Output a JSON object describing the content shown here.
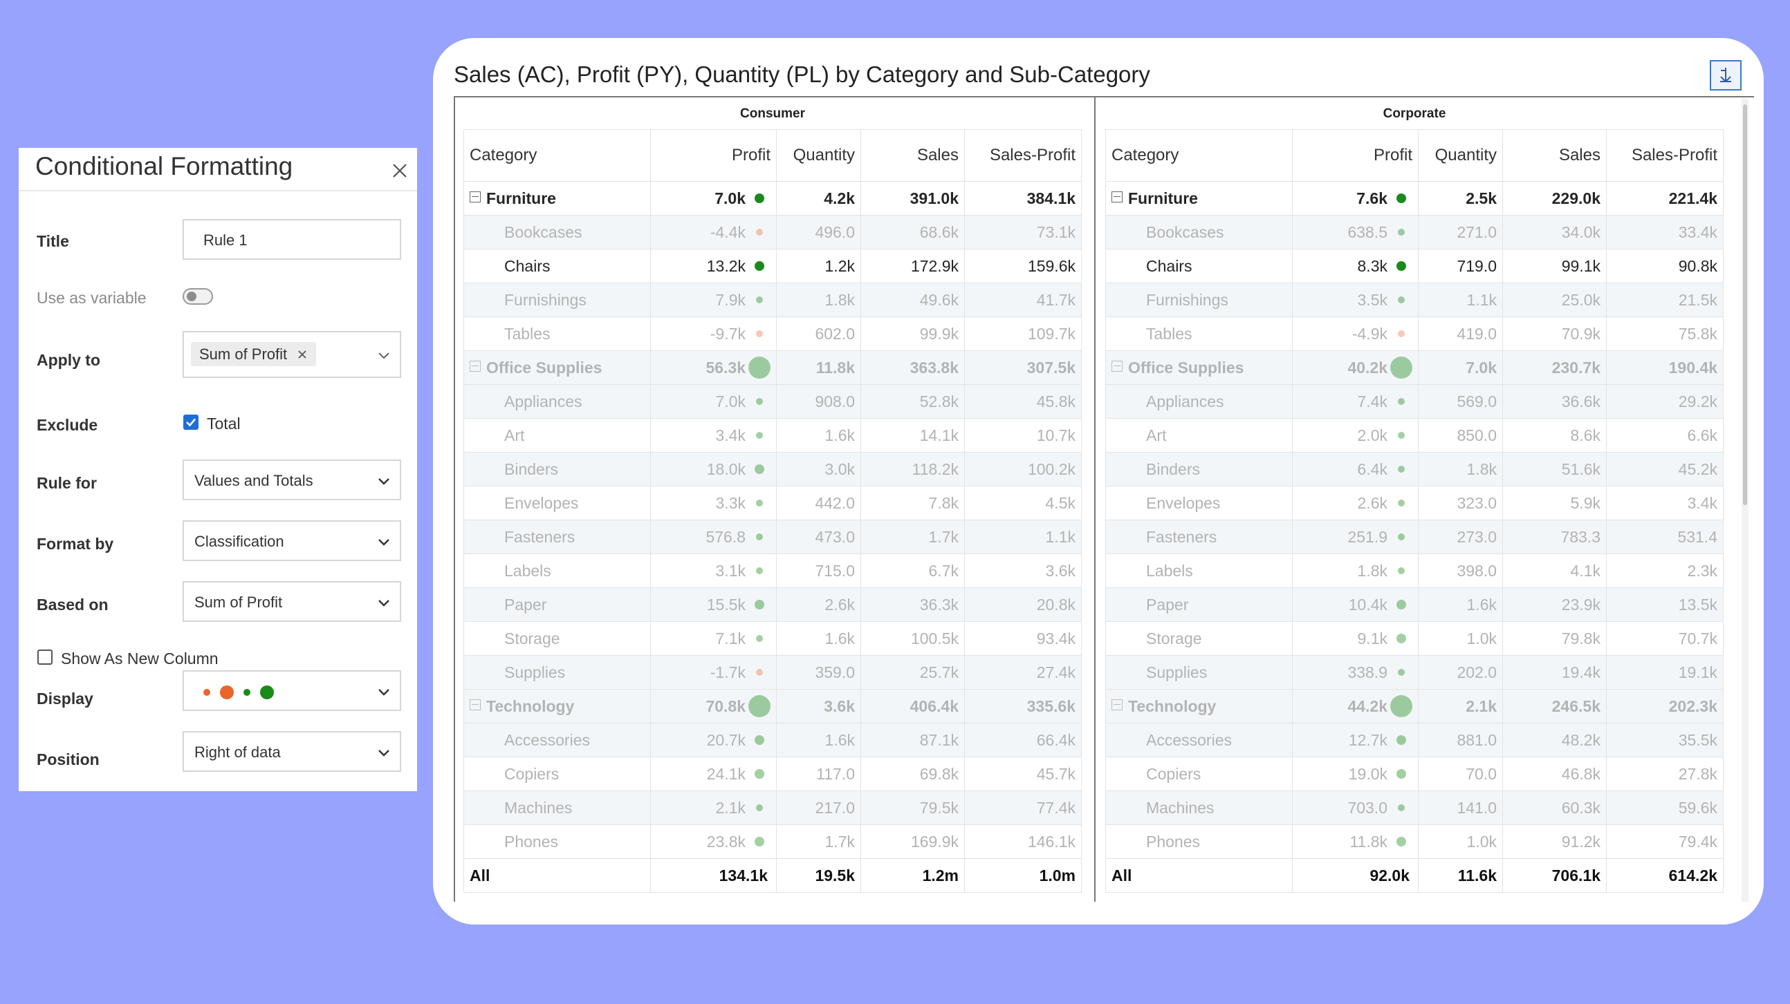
{
  "panel": {
    "title": "Conditional Formatting",
    "fields": {
      "title_label": "Title",
      "title_value": "Rule 1",
      "use_as_variable_label": "Use as variable",
      "use_as_variable_on": false,
      "apply_to_label": "Apply to",
      "apply_to_chip": "Sum of Profit",
      "exclude_label": "Exclude",
      "exclude_option": "Total",
      "exclude_checked": true,
      "rule_for_label": "Rule for",
      "rule_for_value": "Values and Totals",
      "format_by_label": "Format by",
      "format_by_value": "Classification",
      "based_on_label": "Based on",
      "based_on_value": "Sum of Profit",
      "show_new_column_label": "Show As New Column",
      "show_new_column_checked": false,
      "display_label": "Display",
      "display_dot_colors": [
        "#e8652b",
        "#e8652b",
        "#1a8a1a",
        "#1a8a1a"
      ],
      "position_label": "Position",
      "position_value": "Right of data"
    }
  },
  "report": {
    "title": "Sales (AC), Profit (PY), Quantity (PL) by Category and Sub-Category",
    "drill_icon": "hierarchy-icon",
    "columns": [
      "Category",
      "Profit",
      "Quantity",
      "Sales",
      "Sales-Profit"
    ],
    "colors": {
      "positive": "#1a8a1a",
      "negative": "#e8652b"
    },
    "groups": [
      {
        "name": "Consumer",
        "rows": [
          {
            "type": "cat",
            "label": "Furniture",
            "profit": "7.0k",
            "ind": "pos",
            "size": "md",
            "faded": false,
            "qty": "4.2k",
            "sales": "391.0k",
            "sp": "384.1k"
          },
          {
            "type": "sub",
            "label": "Bookcases",
            "profit": "-4.4k",
            "ind": "neg",
            "size": "sm",
            "faded": true,
            "qty": "496.0",
            "sales": "68.6k",
            "sp": "73.1k"
          },
          {
            "type": "sub",
            "label": "Chairs",
            "profit": "13.2k",
            "ind": "pos",
            "size": "md",
            "faded": false,
            "qty": "1.2k",
            "sales": "172.9k",
            "sp": "159.6k"
          },
          {
            "type": "sub",
            "label": "Furnishings",
            "profit": "7.9k",
            "ind": "pos",
            "size": "sm",
            "faded": true,
            "qty": "1.8k",
            "sales": "49.6k",
            "sp": "41.7k"
          },
          {
            "type": "sub",
            "label": "Tables",
            "profit": "-9.7k",
            "ind": "neg",
            "size": "sm",
            "faded": true,
            "qty": "602.0",
            "sales": "99.9k",
            "sp": "109.7k"
          },
          {
            "type": "cat",
            "label": "Office Supplies",
            "profit": "56.3k",
            "ind": "pos",
            "size": "lg",
            "faded": true,
            "qty": "11.8k",
            "sales": "363.8k",
            "sp": "307.5k"
          },
          {
            "type": "sub",
            "label": "Appliances",
            "profit": "7.0k",
            "ind": "pos",
            "size": "sm",
            "faded": true,
            "qty": "908.0",
            "sales": "52.8k",
            "sp": "45.8k"
          },
          {
            "type": "sub",
            "label": "Art",
            "profit": "3.4k",
            "ind": "pos",
            "size": "sm",
            "faded": true,
            "qty": "1.6k",
            "sales": "14.1k",
            "sp": "10.7k"
          },
          {
            "type": "sub",
            "label": "Binders",
            "profit": "18.0k",
            "ind": "pos",
            "size": "md",
            "faded": true,
            "qty": "3.0k",
            "sales": "118.2k",
            "sp": "100.2k"
          },
          {
            "type": "sub",
            "label": "Envelopes",
            "profit": "3.3k",
            "ind": "pos",
            "size": "sm",
            "faded": true,
            "qty": "442.0",
            "sales": "7.8k",
            "sp": "4.5k"
          },
          {
            "type": "sub",
            "label": "Fasteners",
            "profit": "576.8",
            "ind": "pos",
            "size": "sm",
            "faded": true,
            "qty": "473.0",
            "sales": "1.7k",
            "sp": "1.1k"
          },
          {
            "type": "sub",
            "label": "Labels",
            "profit": "3.1k",
            "ind": "pos",
            "size": "sm",
            "faded": true,
            "qty": "715.0",
            "sales": "6.7k",
            "sp": "3.6k"
          },
          {
            "type": "sub",
            "label": "Paper",
            "profit": "15.5k",
            "ind": "pos",
            "size": "md",
            "faded": true,
            "qty": "2.6k",
            "sales": "36.3k",
            "sp": "20.8k"
          },
          {
            "type": "sub",
            "label": "Storage",
            "profit": "7.1k",
            "ind": "pos",
            "size": "sm",
            "faded": true,
            "qty": "1.6k",
            "sales": "100.5k",
            "sp": "93.4k"
          },
          {
            "type": "sub",
            "label": "Supplies",
            "profit": "-1.7k",
            "ind": "neg",
            "size": "sm",
            "faded": true,
            "qty": "359.0",
            "sales": "25.7k",
            "sp": "27.4k"
          },
          {
            "type": "cat",
            "label": "Technology",
            "profit": "70.8k",
            "ind": "pos",
            "size": "lg",
            "faded": true,
            "qty": "3.6k",
            "sales": "406.4k",
            "sp": "335.6k"
          },
          {
            "type": "sub",
            "label": "Accessories",
            "profit": "20.7k",
            "ind": "pos",
            "size": "md",
            "faded": true,
            "qty": "1.6k",
            "sales": "87.1k",
            "sp": "66.4k"
          },
          {
            "type": "sub",
            "label": "Copiers",
            "profit": "24.1k",
            "ind": "pos",
            "size": "md",
            "faded": true,
            "qty": "117.0",
            "sales": "69.8k",
            "sp": "45.7k"
          },
          {
            "type": "sub",
            "label": "Machines",
            "profit": "2.1k",
            "ind": "pos",
            "size": "sm",
            "faded": true,
            "qty": "217.0",
            "sales": "79.5k",
            "sp": "77.4k"
          },
          {
            "type": "sub",
            "label": "Phones",
            "profit": "23.8k",
            "ind": "pos",
            "size": "md",
            "faded": true,
            "qty": "1.7k",
            "sales": "169.9k",
            "sp": "146.1k"
          },
          {
            "type": "total",
            "label": "All",
            "profit": "134.1k",
            "ind": "none",
            "size": "none",
            "faded": false,
            "qty": "19.5k",
            "sales": "1.2m",
            "sp": "1.0m"
          }
        ]
      },
      {
        "name": "Corporate",
        "rows": [
          {
            "type": "cat",
            "label": "Furniture",
            "profit": "7.6k",
            "ind": "pos",
            "size": "md",
            "faded": false,
            "qty": "2.5k",
            "sales": "229.0k",
            "sp": "221.4k"
          },
          {
            "type": "sub",
            "label": "Bookcases",
            "profit": "638.5",
            "ind": "pos",
            "size": "sm",
            "faded": true,
            "qty": "271.0",
            "sales": "34.0k",
            "sp": "33.4k"
          },
          {
            "type": "sub",
            "label": "Chairs",
            "profit": "8.3k",
            "ind": "pos",
            "size": "md",
            "faded": false,
            "qty": "719.0",
            "sales": "99.1k",
            "sp": "90.8k"
          },
          {
            "type": "sub",
            "label": "Furnishings",
            "profit": "3.5k",
            "ind": "pos",
            "size": "sm",
            "faded": true,
            "qty": "1.1k",
            "sales": "25.0k",
            "sp": "21.5k"
          },
          {
            "type": "sub",
            "label": "Tables",
            "profit": "-4.9k",
            "ind": "neg",
            "size": "sm",
            "faded": true,
            "qty": "419.0",
            "sales": "70.9k",
            "sp": "75.8k"
          },
          {
            "type": "cat",
            "label": "Office Supplies",
            "profit": "40.2k",
            "ind": "pos",
            "size": "lg",
            "faded": true,
            "qty": "7.0k",
            "sales": "230.7k",
            "sp": "190.4k"
          },
          {
            "type": "sub",
            "label": "Appliances",
            "profit": "7.4k",
            "ind": "pos",
            "size": "sm",
            "faded": true,
            "qty": "569.0",
            "sales": "36.6k",
            "sp": "29.2k"
          },
          {
            "type": "sub",
            "label": "Art",
            "profit": "2.0k",
            "ind": "pos",
            "size": "sm",
            "faded": true,
            "qty": "850.0",
            "sales": "8.6k",
            "sp": "6.6k"
          },
          {
            "type": "sub",
            "label": "Binders",
            "profit": "6.4k",
            "ind": "pos",
            "size": "sm",
            "faded": true,
            "qty": "1.8k",
            "sales": "51.6k",
            "sp": "45.2k"
          },
          {
            "type": "sub",
            "label": "Envelopes",
            "profit": "2.6k",
            "ind": "pos",
            "size": "sm",
            "faded": true,
            "qty": "323.0",
            "sales": "5.9k",
            "sp": "3.4k"
          },
          {
            "type": "sub",
            "label": "Fasteners",
            "profit": "251.9",
            "ind": "pos",
            "size": "sm",
            "faded": true,
            "qty": "273.0",
            "sales": "783.3",
            "sp": "531.4"
          },
          {
            "type": "sub",
            "label": "Labels",
            "profit": "1.8k",
            "ind": "pos",
            "size": "sm",
            "faded": true,
            "qty": "398.0",
            "sales": "4.1k",
            "sp": "2.3k"
          },
          {
            "type": "sub",
            "label": "Paper",
            "profit": "10.4k",
            "ind": "pos",
            "size": "md",
            "faded": true,
            "qty": "1.6k",
            "sales": "23.9k",
            "sp": "13.5k"
          },
          {
            "type": "sub",
            "label": "Storage",
            "profit": "9.1k",
            "ind": "pos",
            "size": "md",
            "faded": true,
            "qty": "1.0k",
            "sales": "79.8k",
            "sp": "70.7k"
          },
          {
            "type": "sub",
            "label": "Supplies",
            "profit": "338.9",
            "ind": "pos",
            "size": "sm",
            "faded": true,
            "qty": "202.0",
            "sales": "19.4k",
            "sp": "19.1k"
          },
          {
            "type": "cat",
            "label": "Technology",
            "profit": "44.2k",
            "ind": "pos",
            "size": "lg",
            "faded": true,
            "qty": "2.1k",
            "sales": "246.5k",
            "sp": "202.3k"
          },
          {
            "type": "sub",
            "label": "Accessories",
            "profit": "12.7k",
            "ind": "pos",
            "size": "md",
            "faded": true,
            "qty": "881.0",
            "sales": "48.2k",
            "sp": "35.5k"
          },
          {
            "type": "sub",
            "label": "Copiers",
            "profit": "19.0k",
            "ind": "pos",
            "size": "md",
            "faded": true,
            "qty": "70.0",
            "sales": "46.8k",
            "sp": "27.8k"
          },
          {
            "type": "sub",
            "label": "Machines",
            "profit": "703.0",
            "ind": "pos",
            "size": "sm",
            "faded": true,
            "qty": "141.0",
            "sales": "60.3k",
            "sp": "59.6k"
          },
          {
            "type": "sub",
            "label": "Phones",
            "profit": "11.8k",
            "ind": "pos",
            "size": "md",
            "faded": true,
            "qty": "1.0k",
            "sales": "91.2k",
            "sp": "79.4k"
          },
          {
            "type": "total",
            "label": "All",
            "profit": "92.0k",
            "ind": "none",
            "size": "none",
            "faded": false,
            "qty": "11.6k",
            "sales": "706.1k",
            "sp": "614.2k"
          }
        ]
      }
    ]
  }
}
